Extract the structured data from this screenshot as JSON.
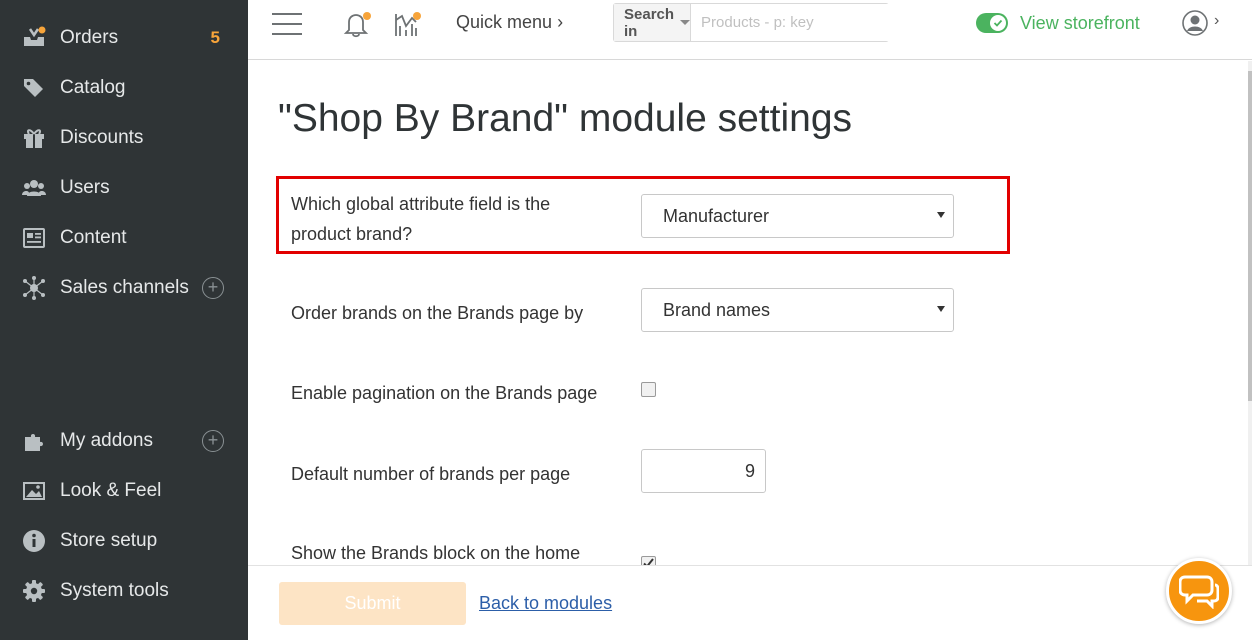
{
  "sidebar": {
    "items": [
      {
        "label": "Orders",
        "icon": "orders-icon",
        "badge": "5"
      },
      {
        "label": "Catalog",
        "icon": "catalog-icon"
      },
      {
        "label": "Discounts",
        "icon": "gift-icon"
      },
      {
        "label": "Users",
        "icon": "users-icon"
      },
      {
        "label": "Content",
        "icon": "content-icon"
      },
      {
        "label": "Sales channels",
        "icon": "network-icon",
        "plus": "+"
      },
      {
        "label": "My addons",
        "icon": "puzzle-icon",
        "plus": "+"
      },
      {
        "label": "Look & Feel",
        "icon": "image-icon"
      },
      {
        "label": "Store setup",
        "icon": "info-icon"
      },
      {
        "label": "System tools",
        "icon": "gear-icon"
      }
    ]
  },
  "topbar": {
    "quick_menu": "Quick menu",
    "quick_menu_caret": "›",
    "search_in": "Search in",
    "search_placeholder": "Products - p: key",
    "storefront": "View storefront",
    "profile_caret": "›"
  },
  "page": {
    "title": "\"Shop By Brand\" module settings"
  },
  "form": {
    "brand_field_label_line1": "Which global attribute field is the",
    "brand_field_label_line2": "product brand?",
    "brand_field_value": "Manufacturer",
    "order_label": "Order brands on the Brands page by",
    "order_value": "Brand names",
    "pagination_label": "Enable pagination on the Brands page",
    "pagination_checked": false,
    "per_page_label": "Default number of brands per page",
    "per_page_value": "9",
    "home_block_label": "Show the Brands block on the home",
    "home_block_checked": true
  },
  "footer": {
    "submit": "Submit",
    "back": "Back to modules"
  },
  "colors": {
    "sidebar_bg": "#2f3436",
    "accent_orange": "#f7a43a",
    "storefront_green": "#4bb35f",
    "highlight_red": "#e20000",
    "link_blue": "#2c5ea8"
  }
}
